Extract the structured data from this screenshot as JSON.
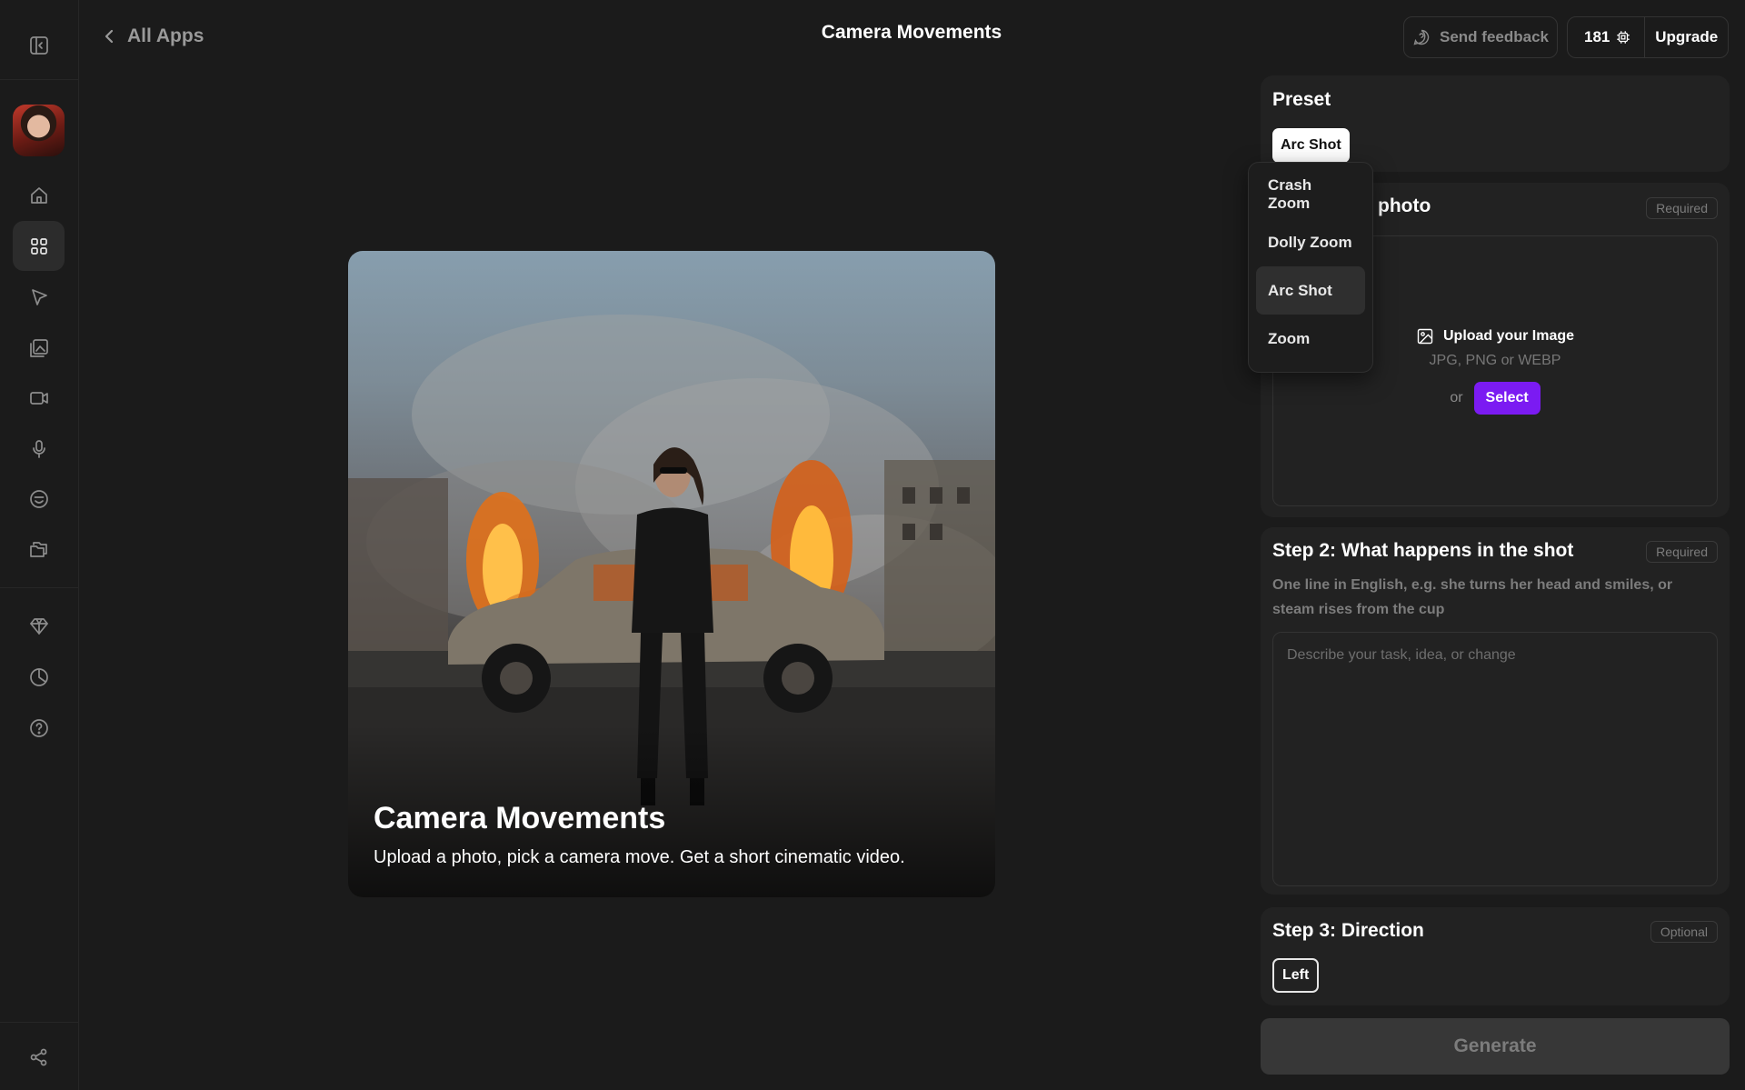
{
  "header": {
    "back_label": "All Apps",
    "title": "Camera Movements",
    "feedback_label": "Send feedback",
    "credits": "181",
    "upgrade_label": "Upgrade"
  },
  "hero": {
    "title": "Camera Movements",
    "subtitle": "Upload a photo, pick a camera move. Get a short cinematic video."
  },
  "preset": {
    "title": "Preset",
    "selected": "Arc Shot",
    "options": [
      "Crash Zoom",
      "Dolly Zoom",
      "Arc Shot",
      "Zoom"
    ]
  },
  "step1": {
    "title_visible": "photo",
    "tag": "Required",
    "upload_label": "Upload your Image",
    "upload_hint": "JPG, PNG or WEBP",
    "or_label": "or",
    "select_label": "Select"
  },
  "step2": {
    "title": "Step 2: What happens in the shot",
    "tag": "Required",
    "description": "One line in English, e.g. she turns her head and smiles, or steam rises from the cup",
    "placeholder": "Describe your task, idea, or change",
    "value": ""
  },
  "step3": {
    "title": "Step 3: Direction",
    "tag": "Optional",
    "selected": "Left"
  },
  "generate_label": "Generate",
  "sidebar": {
    "icons": [
      "panel-toggle-icon",
      "home-icon",
      "apps-grid-icon",
      "cursor-icon",
      "image-edit-icon",
      "video-icon",
      "microphone-icon",
      "emoji-icon",
      "folder-icon",
      "diamond-icon",
      "pie-chart-icon",
      "help-icon",
      "share-icon"
    ],
    "active": "apps-grid-icon"
  },
  "colors": {
    "background": "#1b1b1b",
    "panel": "#222222",
    "accent": "#7b1bf2",
    "generate_disabled": "#373737"
  }
}
